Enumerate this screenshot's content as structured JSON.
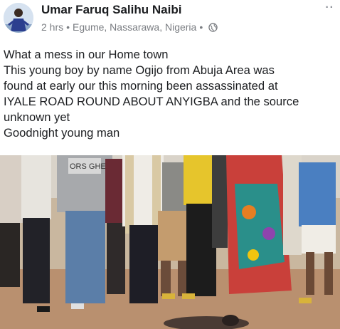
{
  "post": {
    "author": "Umar Faruq Salihu Naibi",
    "time": "2 hrs",
    "location": "Egume, Nassarawa, Nigeria",
    "separator": "•",
    "more_label": "··",
    "privacy_icon": "globe-icon",
    "text_lines": [
      "What a mess in our Home town",
      "This young boy by name Ogijo from Abuja Area  was",
      "found at early our this morning been assassinated at",
      "IYALE ROAD ROUND ABOUT ANYIGBA and the source",
      "unknown yet",
      "Goodnight young man"
    ],
    "shirt_text": "ORS GHE"
  }
}
